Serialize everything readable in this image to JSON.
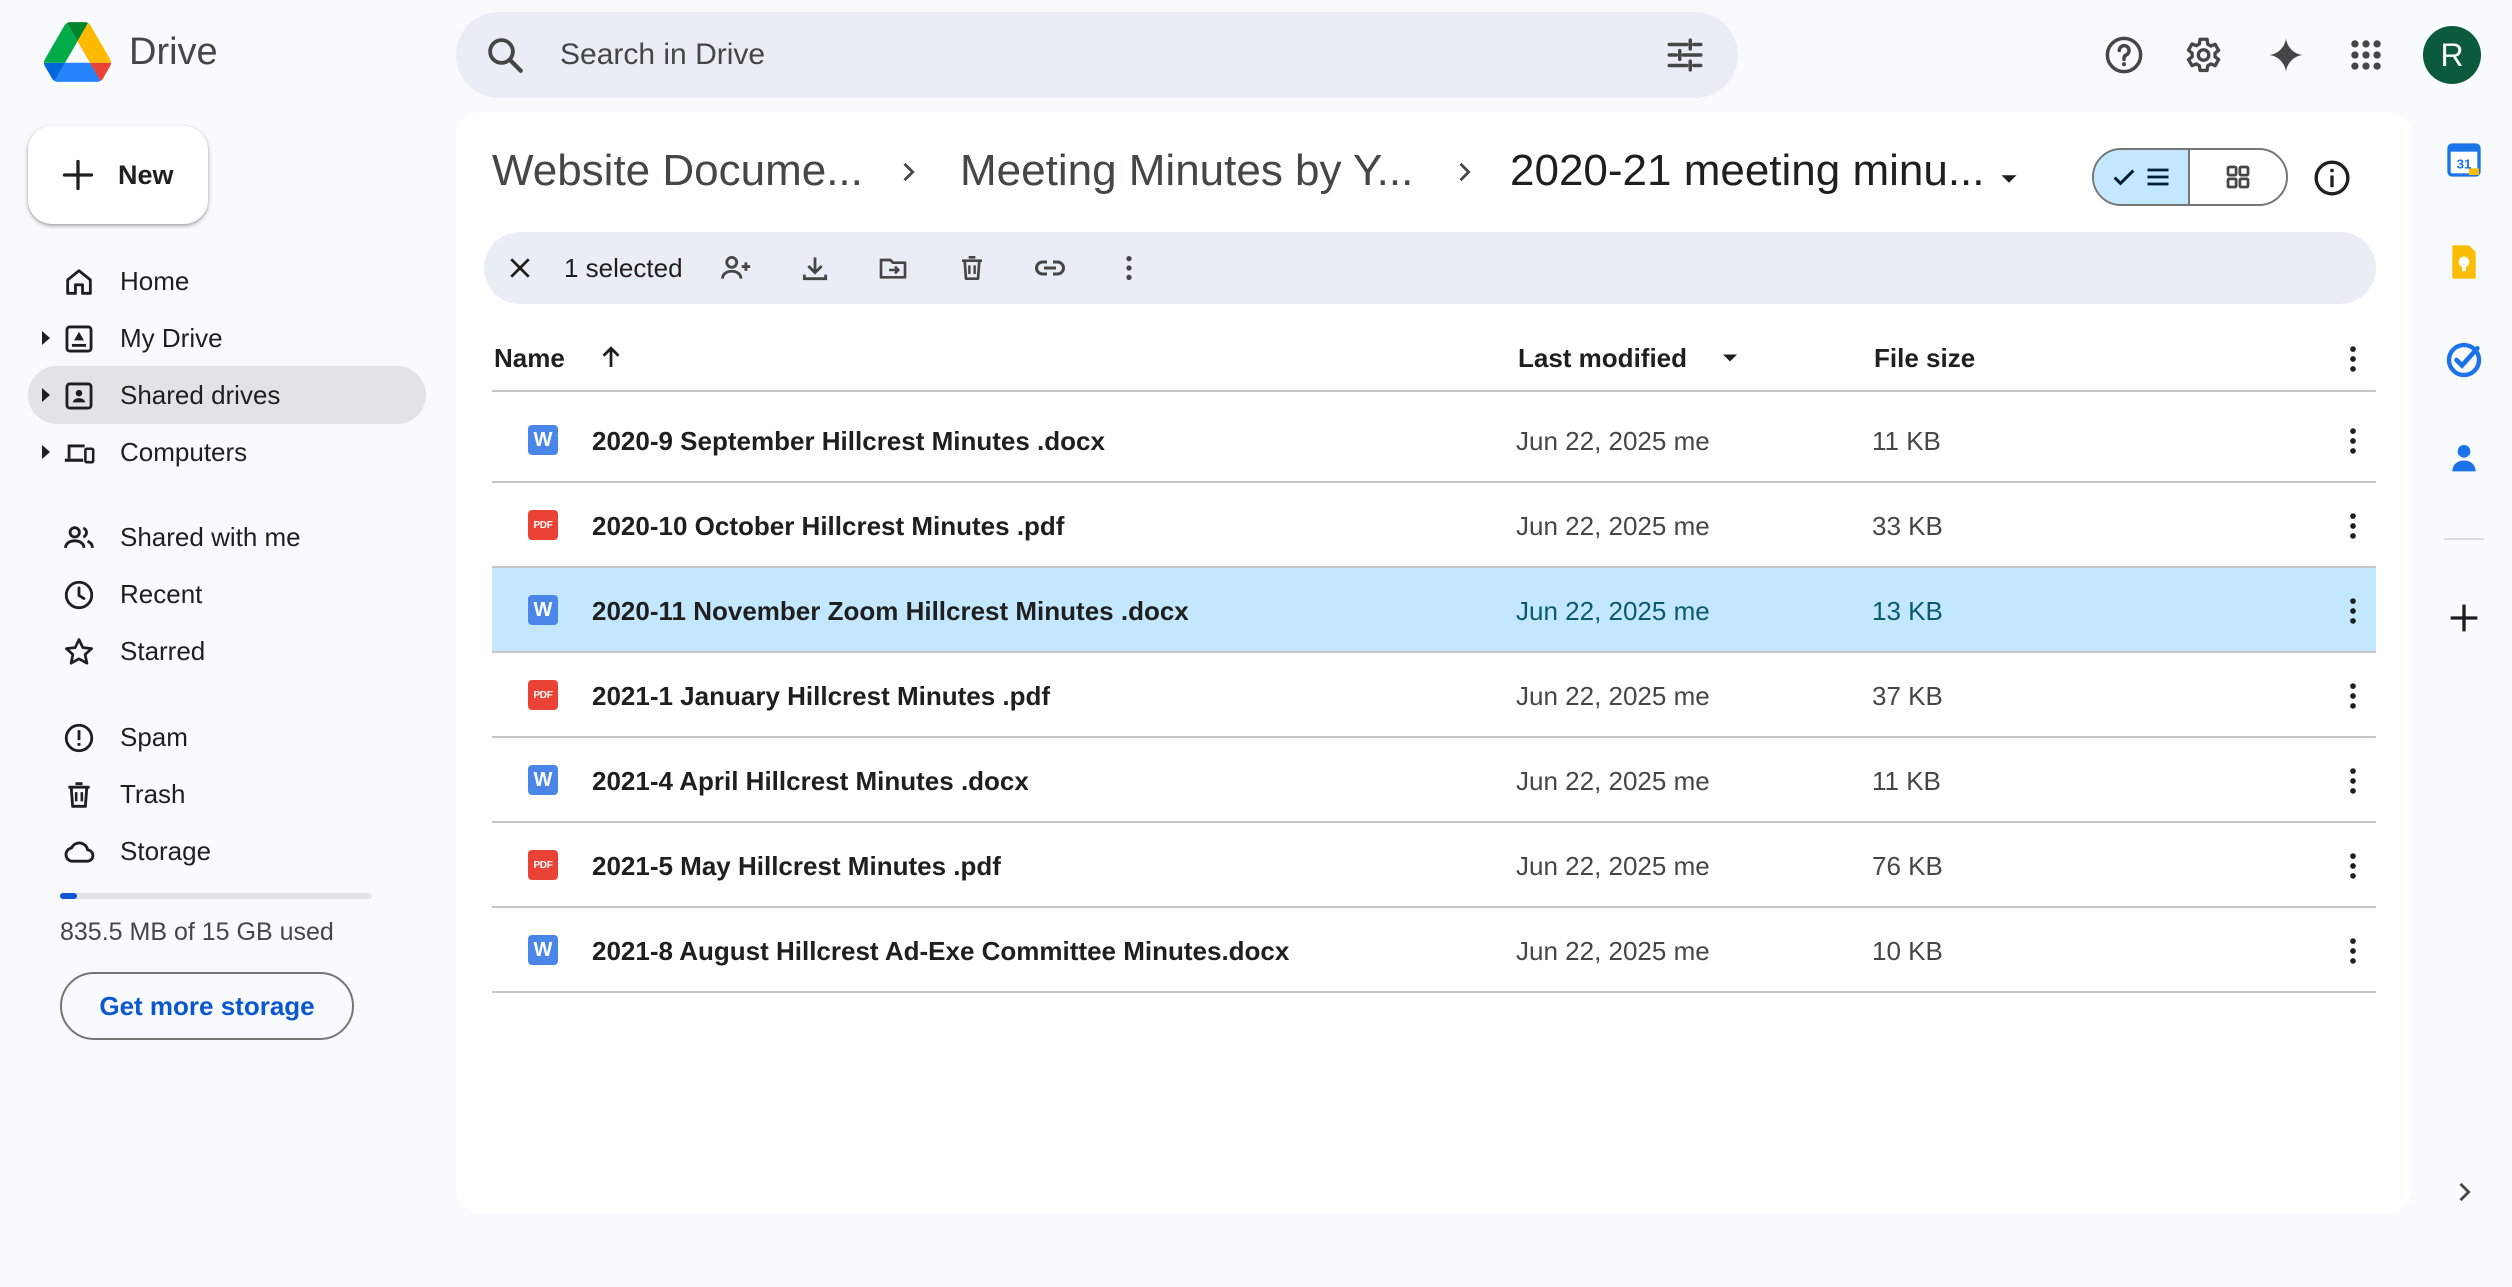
{
  "app": {
    "name": "Drive"
  },
  "search": {
    "placeholder": "Search in Drive"
  },
  "sidebar": {
    "new_label": "New",
    "items": [
      {
        "label": "Home",
        "icon": "home-icon"
      },
      {
        "label": "My Drive",
        "icon": "my-drive-icon"
      },
      {
        "label": "Shared drives",
        "icon": "shared-drives-icon",
        "active": true
      },
      {
        "label": "Computers",
        "icon": "computers-icon"
      },
      {
        "label": "Shared with me",
        "icon": "shared-with-me-icon"
      },
      {
        "label": "Recent",
        "icon": "clock-icon"
      },
      {
        "label": "Starred",
        "icon": "star-icon"
      },
      {
        "label": "Spam",
        "icon": "spam-icon"
      },
      {
        "label": "Trash",
        "icon": "trash-icon"
      },
      {
        "label": "Storage",
        "icon": "cloud-icon"
      }
    ],
    "storage": {
      "used_text": "835.5 MB of 15 GB used",
      "used_fraction": 0.056,
      "button_label": "Get more storage"
    }
  },
  "breadcrumb": [
    "Website Docume...",
    "Meeting Minutes by Y...",
    "2020-21 meeting minu..."
  ],
  "avatar_initial": "R",
  "selection": {
    "count_label": "1 selected"
  },
  "table": {
    "columns": {
      "name": "Name",
      "modified": "Last modified",
      "size": "File size"
    },
    "rows": [
      {
        "name": "2020-9 September Hillcrest Minutes .docx",
        "type": "word",
        "modified": "Jun 22, 2025 me",
        "size": "11 KB",
        "selected": false
      },
      {
        "name": "2020-10 October Hillcrest Minutes .pdf",
        "type": "pdf",
        "modified": "Jun 22, 2025 me",
        "size": "33 KB",
        "selected": false
      },
      {
        "name": "2020-11 November Zoom Hillcrest Minutes .docx",
        "type": "word",
        "modified": "Jun 22, 2025 me",
        "size": "13 KB",
        "selected": true
      },
      {
        "name": "2021-1 January Hillcrest Minutes .pdf",
        "type": "pdf",
        "modified": "Jun 22, 2025 me",
        "size": "37 KB",
        "selected": false
      },
      {
        "name": "2021-4 April Hillcrest Minutes .docx",
        "type": "word",
        "modified": "Jun 22, 2025 me",
        "size": "11 KB",
        "selected": false
      },
      {
        "name": "2021-5 May Hillcrest Minutes .pdf",
        "type": "pdf",
        "modified": "Jun 22, 2025 me",
        "size": "76 KB",
        "selected": false
      },
      {
        "name": "2021-8 August Hillcrest Ad-Exe Committee Minutes.docx",
        "type": "word",
        "modified": "Jun 22, 2025 me",
        "size": "10 KB",
        "selected": false
      }
    ]
  },
  "file_badges": {
    "word": "W",
    "pdf": "PDF"
  },
  "right_rail": [
    "calendar-icon",
    "keep-icon",
    "tasks-icon",
    "contacts-icon",
    "add-icon"
  ],
  "colors": {
    "accent": "#0b57d0",
    "selected_row": "#c2e7ff",
    "avatar": "#0b5a3e",
    "word": "#4a86e8",
    "pdf": "#ea4335"
  }
}
